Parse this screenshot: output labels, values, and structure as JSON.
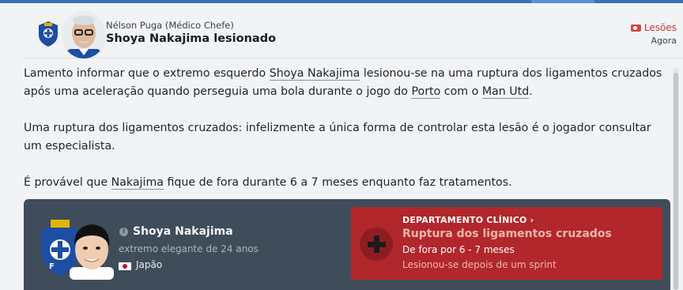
{
  "header": {
    "sender": "Nélson Puga  (Médico Chefe)",
    "subject": "Shoya Nakajima lesionado",
    "tag_label": "Lesões",
    "time": "Agora"
  },
  "message": {
    "p1_a": "Lamento informar que o extremo esquerdo ",
    "p1_player": "Shoya Nakajima",
    "p1_b": " lesionou-se na uma ruptura dos ligamentos cruzados após uma aceleração quando perseguia uma bola durante o jogo do ",
    "p1_club": "Porto",
    "p1_c": " com o ",
    "p1_opponent": "Man Utd",
    "p1_d": ".",
    "p2": "Uma ruptura dos ligamentos cruzados: infelizmente a única forma de controlar esta lesão é o jogador consultar um especialista.",
    "p3_a": "É provável que ",
    "p3_player": "Nakajima",
    "p3_b": " fique de fora durante 6 a 7 meses enquanto faz tratamentos."
  },
  "player_card": {
    "name": "Shoya Nakajima",
    "info_glyph": "i",
    "description": "extremo elegante de 24 anos",
    "nationality": "Japão"
  },
  "medical": {
    "department": "DEPARTAMENTO CLÍNICO ›",
    "injury": "Ruptura dos ligamentos cruzados",
    "duration": "De fora por 6 - 7 meses",
    "cause": "Lesionou-se depois de um sprint"
  },
  "colors": {
    "accent": "#3a6fb6",
    "card_bg": "#3f4d5a",
    "medical_bg": "#b2272b",
    "tag": "#c23b35"
  },
  "icons": [
    "club-crest-icon",
    "injury-tag-icon",
    "info-icon",
    "flag-japan-icon",
    "medical-cross-icon"
  ]
}
